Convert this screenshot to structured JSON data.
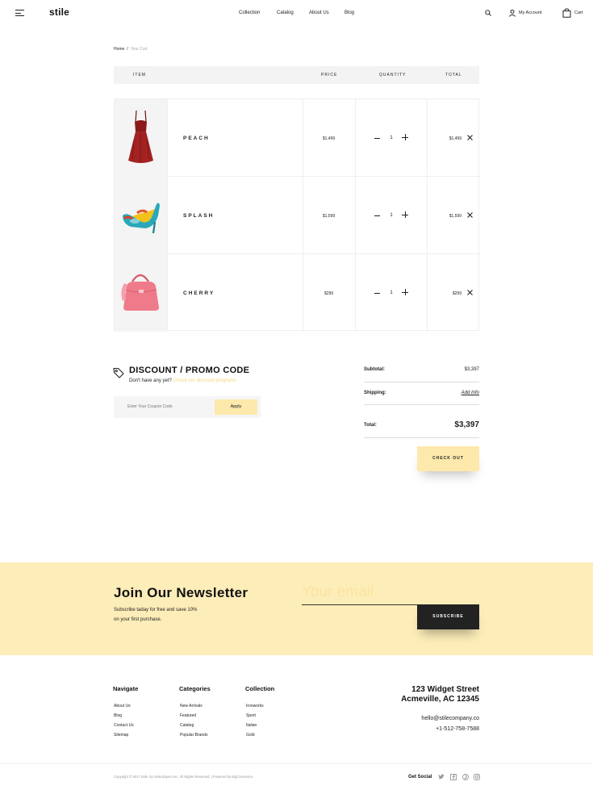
{
  "header": {
    "logo": "stile",
    "nav": [
      "Collection",
      "Catalog",
      "About Us",
      "Blog"
    ],
    "account_label": "My Account",
    "cart_label": "Cart"
  },
  "breadcrumb": {
    "home": "Home",
    "separator": "/",
    "current": "Your Cart"
  },
  "table": {
    "headers": {
      "item": "ITEM",
      "price": "PRICE",
      "quantity": "QUANTITY",
      "total": "TOTAL"
    },
    "rows": [
      {
        "name": "PEACH",
        "price": "$1,499",
        "quantity": "1",
        "total": "$1,499",
        "image_icon": "red-dress-icon"
      },
      {
        "name": "SPLASH",
        "price": "$1,599",
        "quantity": "1",
        "total": "$1,599",
        "image_icon": "heel-shoe-icon"
      },
      {
        "name": "CHERRY",
        "price": "$299",
        "quantity": "1",
        "total": "$299",
        "image_icon": "pink-handbag-icon"
      }
    ]
  },
  "discount": {
    "title": "DISCOUNT / PROMO CODE",
    "prompt": "Don't have any yet?",
    "link": "Check our discount programs",
    "placeholder": "Enter Your Coupon Code",
    "apply_label": "Apply"
  },
  "summary": {
    "subtotal_label": "Subtotal:",
    "subtotal_value": "$3,397",
    "shipping_label": "Shipping:",
    "shipping_value": "Add Info",
    "total_label": "Total:",
    "total_value": "$3,397",
    "checkout_label": "CHECK OUT"
  },
  "newsletter": {
    "title": "Join Our Newsletter",
    "line1": "Subscribe taday for free and save 10%",
    "line2": "on your first purchase.",
    "email_placeholder": "Your email",
    "subscribe_label": "SUBSCRIBE"
  },
  "footer": {
    "navigate": {
      "title": "Navigate",
      "links": [
        "About Us",
        "Blog",
        "Contact Us",
        "Sitemap"
      ]
    },
    "categories": {
      "title": "Categories",
      "links": [
        "New Arrivals",
        "Featured",
        "Catalog",
        "Popular Brands"
      ]
    },
    "collection": {
      "title": "Collection",
      "links": [
        "Ironworks",
        "Sport",
        "Italian",
        "Gold"
      ]
    },
    "address_line1": "123 Widget Street",
    "address_line2": "Acmeville, AC 12345",
    "email": "hello@stilecompany.co",
    "phone": "+1-512-758-7588",
    "copyright": "Copyright © 2017 Stile. by Selectlayers Inc. All Rights Reserved. | Powered by BigCommerce",
    "social_label": "Get Social",
    "social_icons": [
      "twitter-icon",
      "facebook-icon",
      "pinterest-icon",
      "instagram-icon"
    ]
  },
  "colors": {
    "accent": "#fde9ac",
    "newsletter_bg": "#fdedb8",
    "dark": "#222222",
    "link": "#f6d77e"
  }
}
